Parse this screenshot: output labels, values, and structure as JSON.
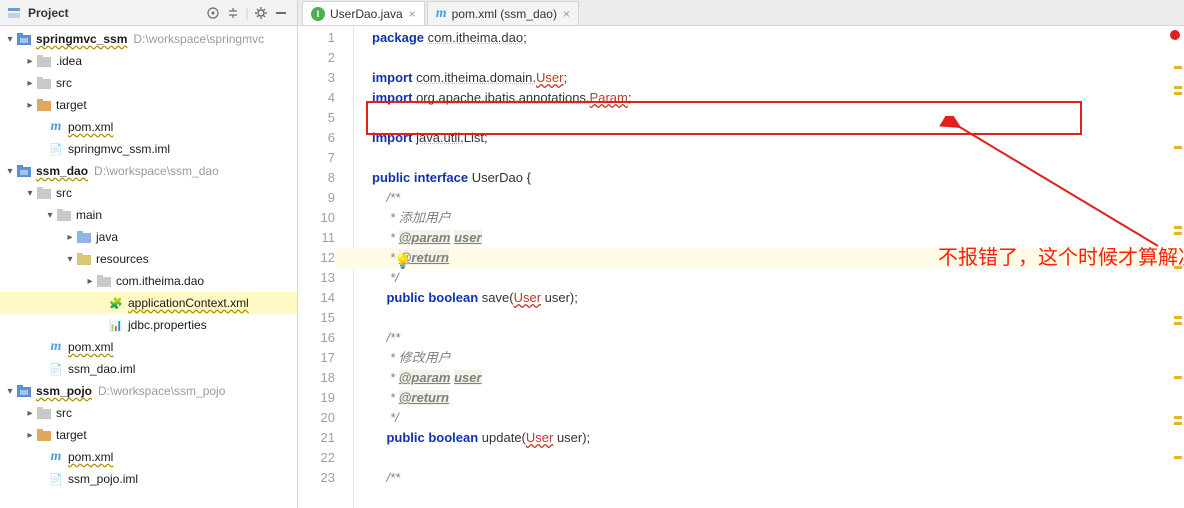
{
  "sidebar": {
    "title": "Project",
    "tree": {
      "springmvc_ssm": {
        "name": "springmvc_ssm",
        "hint": "D:\\workspace\\springmvc"
      },
      "idea": ".idea",
      "src1": "src",
      "target1": "target",
      "pom1": "pom.xml",
      "iml1": "springmvc_ssm.iml",
      "ssm_dao": {
        "name": "ssm_dao",
        "hint": "D:\\workspace\\ssm_dao"
      },
      "src2": "src",
      "main": "main",
      "java": "java",
      "resources": "resources",
      "pkg": "com.itheima.dao",
      "appctx": "applicationContext.xml",
      "jdbc": "jdbc.properties",
      "pom2": "pom.xml",
      "iml2": "ssm_dao.iml",
      "ssm_pojo": {
        "name": "ssm_pojo",
        "hint": "D:\\workspace\\ssm_pojo"
      },
      "src3": "src",
      "target3": "target",
      "pom3": "pom.xml",
      "iml3": "ssm_pojo.iml"
    }
  },
  "tabs": {
    "userdao": "UserDao.java",
    "pom": "pom.xml (ssm_dao)"
  },
  "code": {
    "l1a": "package",
    "l1b": "com.itheima.dao",
    "l1c": ";",
    "l3a": "import",
    "l3b": "com.itheima.domain.",
    "l3c": "User",
    "l3d": ";",
    "l4a": "import",
    "l4b": "org.apache.ibatis.annotations.",
    "l4c": "Param",
    "l4d": ";",
    "l6a": "import",
    "l6b": "java.util.",
    "l6c": "List",
    "l6d": ";",
    "l8a": "public interface",
    "l8b": " UserDao {",
    "l9": "    /**",
    "l10": "     * 添加用户",
    "l11a": "     * ",
    "l11b": "@param",
    "l11c": " ",
    "l11d": "user",
    "l12a": "     * ",
    "l12b": "@return",
    "l13": "     */",
    "l14a": "    public boolean",
    "l14b": " save(",
    "l14c": "User",
    "l14d": " user);",
    "l16": "    /**",
    "l17": "     * 修改用户",
    "l18a": "     * ",
    "l18b": "@param",
    "l18c": " ",
    "l18d": "user",
    "l19a": "     * ",
    "l19b": "@return",
    "l20": "     */",
    "l21a": "    public boolean",
    "l21b": " update(",
    "l21c": "User",
    "l21d": " user);",
    "l23": "    /**"
  },
  "annotation": "不报错了，这个时候才算解决了资源加载问题",
  "line_count": 23
}
